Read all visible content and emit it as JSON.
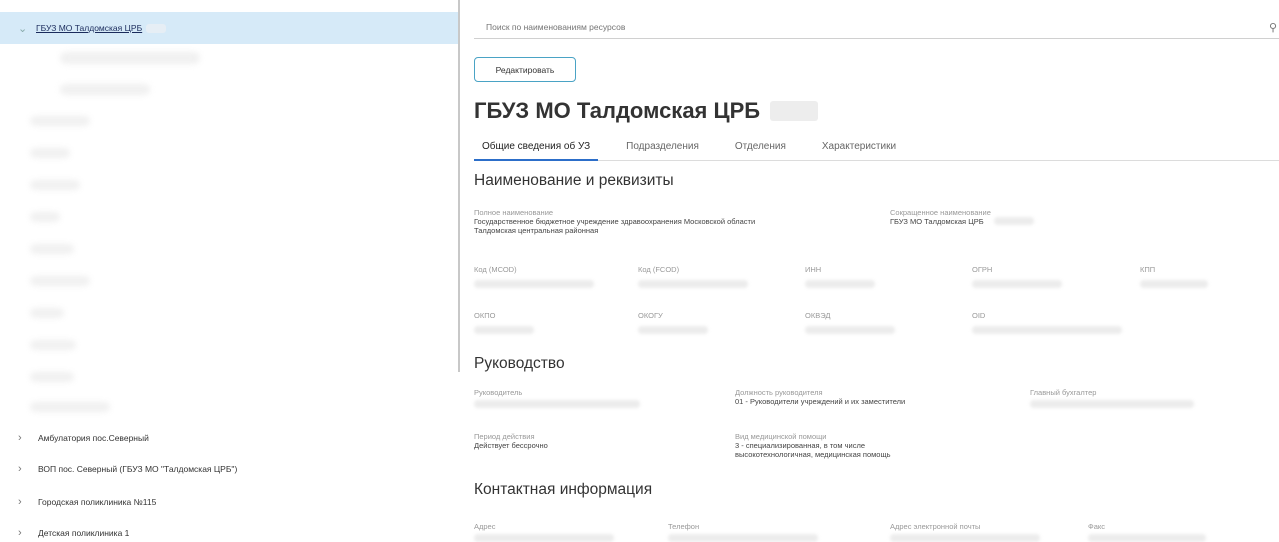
{
  "tree": {
    "selected_label": "ГБУЗ МО Талдомская ЦРБ",
    "items": [
      {
        "label": "Амбулатория пос.Северный"
      },
      {
        "label": "ВОП пос. Северный (ГБУЗ МО \"Талдомская ЦРБ\")"
      },
      {
        "label": "Городская поликлиника №115"
      },
      {
        "label": "Детская поликлиника 1"
      }
    ]
  },
  "search": {
    "placeholder": "Поиск по наименованиям ресурсов"
  },
  "toolbar": {
    "edit_label": "Редактировать"
  },
  "page_title": "ГБУЗ МО Талдомская ЦРБ",
  "tabs": [
    {
      "label": "Общие сведения об УЗ",
      "active": true
    },
    {
      "label": "Подразделения"
    },
    {
      "label": "Отделения"
    },
    {
      "label": "Характеристики"
    }
  ],
  "requisites": {
    "heading": "Наименование и реквизиты",
    "full_name_label": "Полное наименование",
    "full_name_line1": "Государственное бюджетное учреждение здравоохранения Московской области",
    "full_name_line2": "Талдомская центральная районная",
    "short_name_label": "Сокращенное наименование",
    "short_name_value": "ГБУЗ МО Талдомская ЦРБ",
    "mcod_label": "Код (МСОD)",
    "fcod_label": "Код (FCOD)",
    "inn_label": "ИНН",
    "ogrn_label": "ОГРН",
    "kpp_label": "КПП",
    "okpo_label": "ОКПО",
    "okogu_label": "ОКОГУ",
    "okved_label": "ОКВЭД",
    "oid_label": "OID"
  },
  "management": {
    "heading": "Руководство",
    "head_label": "Руководитель",
    "position_label": "Должность руководителя",
    "position_value": "01 - Руководители учреждений и их заместители",
    "accountant_label": "Главный бухгалтер",
    "period_label": "Период действия",
    "period_value": "Действует бессрочно",
    "care_label": "Вид медицинской помощи",
    "care_line1": "3 - специализированная, в том числе",
    "care_line2": "высокотехнологичная, медицинская помощь"
  },
  "contacts": {
    "heading": "Контактная информация",
    "address_label": "Адрес",
    "phone_label": "Телефон",
    "email_label": "Адрес электронной почты",
    "fax_label": "Факс"
  }
}
